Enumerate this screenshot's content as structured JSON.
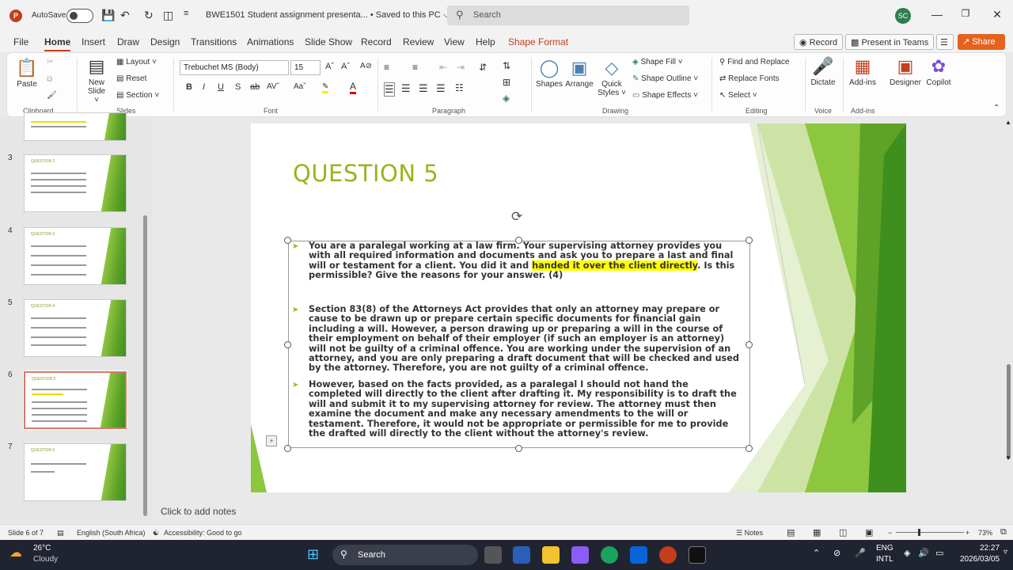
{
  "titlebar": {
    "autosave_label": "AutoSave",
    "app_logo": "P",
    "doc_title": "BWE1501 Student assignment presenta...  •  Saved to this PC ⌵",
    "search_placeholder": "Search",
    "avatar_initials": "SC"
  },
  "menubar": {
    "tabs": [
      "File",
      "Home",
      "Insert",
      "Draw",
      "Design",
      "Transitions",
      "Animations",
      "Slide Show",
      "Record",
      "Review",
      "View",
      "Help",
      "Shape Format"
    ],
    "record_btn": "Record",
    "present_teams_btn": "Present in Teams",
    "share_btn": "Share"
  },
  "ribbon": {
    "paste": "Paste",
    "new_slide": "New Slide ˅",
    "layout": "Layout ˅",
    "reset": "Reset",
    "section": "Section ˅",
    "font_name": "Trebuchet MS (Body)",
    "font_size": "15",
    "shapes": "Shapes",
    "arrange": "Arrange",
    "quick_styles": "Quick Styles ˅",
    "shape_fill": "Shape Fill ˅",
    "shape_outline": "Shape Outline ˅",
    "shape_effects": "Shape Effects ˅",
    "find_replace": "Find and Replace",
    "replace_fonts": "Replace Fonts",
    "select": "Select ˅",
    "dictate": "Dictate",
    "addins": "Add-ins",
    "designer": "Designer",
    "copilot": "Copilot",
    "groups": {
      "clipboard": "Clipboard",
      "slides": "Slides",
      "font": "Font",
      "paragraph": "Paragraph",
      "drawing": "Drawing",
      "editing": "Editing",
      "voice": "Voice",
      "addins": "Add-ins"
    }
  },
  "thumbnails": [
    {
      "num": "3",
      "title": "QUESTION 2"
    },
    {
      "num": "4",
      "title": "QUESTION 3"
    },
    {
      "num": "5",
      "title": "QUESTION 4"
    },
    {
      "num": "6",
      "title": "QUESTION 5"
    },
    {
      "num": "7",
      "title": "QUESTION 6"
    }
  ],
  "slide": {
    "title": "QUESTION 5",
    "bullet1_pre": "You are a paralegal working at a law firm. Your supervising attorney provides you with all required information and documents and ask you to prepare a last and final will or testament for a client. You did it and ",
    "bullet1_hl": "handed it over the client directly",
    "bullet1_post": ". Is this permissible? Give the reasons for your answer. (4)",
    "bullet2": "Section 83(8) of the Attorneys Act provides that only an attorney may prepare or cause to be drawn up or prepare certain specific documents for financial gain including a will. However, a person drawing up or preparing a will in the course of their employment on behalf of their employer (if such an employer is an attorney) will not be guilty of a criminal offence. You are working under the supervision of an attorney, and you are only preparing a draft document that will be checked and used by the attorney. Therefore, you are not guilty of a criminal offence.",
    "bullet3": "However, based on the facts provided, as a paralegal I should not hand the completed will directly to the client after drafting it. My responsibility is to draft the will and submit it to my supervising attorney for review. The attorney must then examine the document and make any necessary amendments to the will or testament. Therefore, it would not be appropriate or permissible for me to provide the drafted will directly to the client without the attorney's review."
  },
  "notes_placeholder": "Click to add notes",
  "statusbar": {
    "slide_count": "Slide 6 of 7",
    "language": "English (South Africa)",
    "accessibility": "Accessibility: Good to go",
    "notes": "Notes",
    "zoom": "73%"
  },
  "taskbar": {
    "weather_temp": "26°C",
    "weather_desc": "Cloudy",
    "search": "Search",
    "lang1": "ENG",
    "lang2": "INTL",
    "time": "22:27",
    "date": "2026/03/05"
  }
}
